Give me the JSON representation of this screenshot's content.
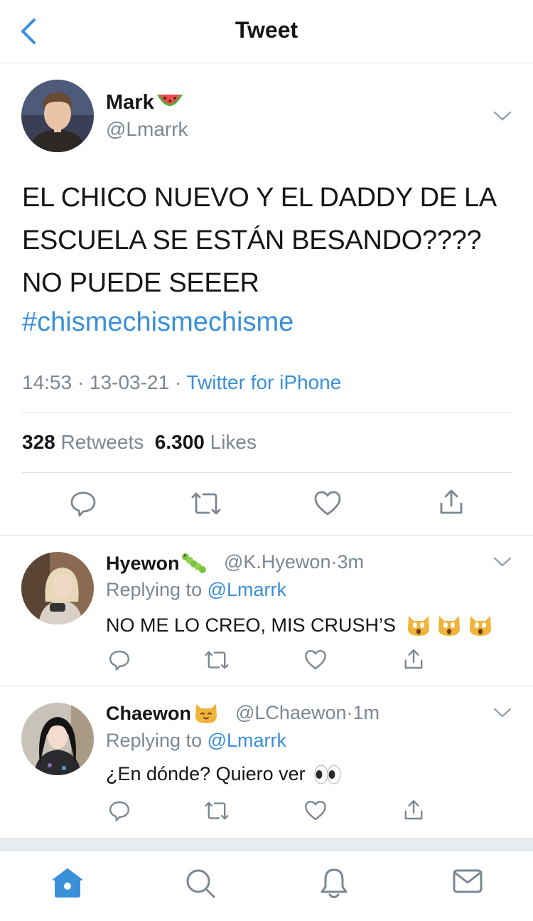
{
  "header": {
    "title": "Tweet"
  },
  "main_tweet": {
    "name": "Mark",
    "name_emoji": "watermelon-emoji",
    "handle": "@Lmarrk",
    "text": "EL CHICO NUEVO Y EL DADDY DE LA ESCUELA SE ESTÁN BESANDO???? NO PUEDE SEEER",
    "hashtag": "#chismechismechisme",
    "time": "14:53",
    "date": "13-03-21",
    "separator": "·",
    "source": "Twitter for iPhone",
    "retweets_count": "328",
    "retweets_label": "Retweets",
    "likes_count": "6.300",
    "likes_label": "Likes"
  },
  "replies": [
    {
      "name": "Hyewon",
      "name_emoji": "caterpillar-emoji",
      "handle": "@K.Hyewon",
      "sep": "·",
      "time": "3m",
      "replying_prefix": "Replying to",
      "replying_to": "@Lmarrk",
      "text": "NO ME LO CREO, MIS CRUSH’S",
      "text_emojis": [
        "screaming-cat-emoji",
        "screaming-cat-emoji",
        "screaming-cat-emoji"
      ]
    },
    {
      "name": "Chaewon",
      "name_emoji": "cat-face-emoji",
      "handle": "@LChaewon",
      "sep": "·",
      "time": "1m",
      "replying_prefix": "Replying to",
      "replying_to": "@Lmarrk",
      "text": "¿En dónde? Quiero ver",
      "text_emojis": [
        "eyes-emoji"
      ]
    }
  ],
  "tabbar": {
    "items": [
      "home-icon",
      "search-icon",
      "notifications-icon",
      "messages-icon"
    ]
  },
  "colors": {
    "accent": "#3a8fd9",
    "secondary_text": "#7c8791",
    "divider": "#dadfe3"
  }
}
